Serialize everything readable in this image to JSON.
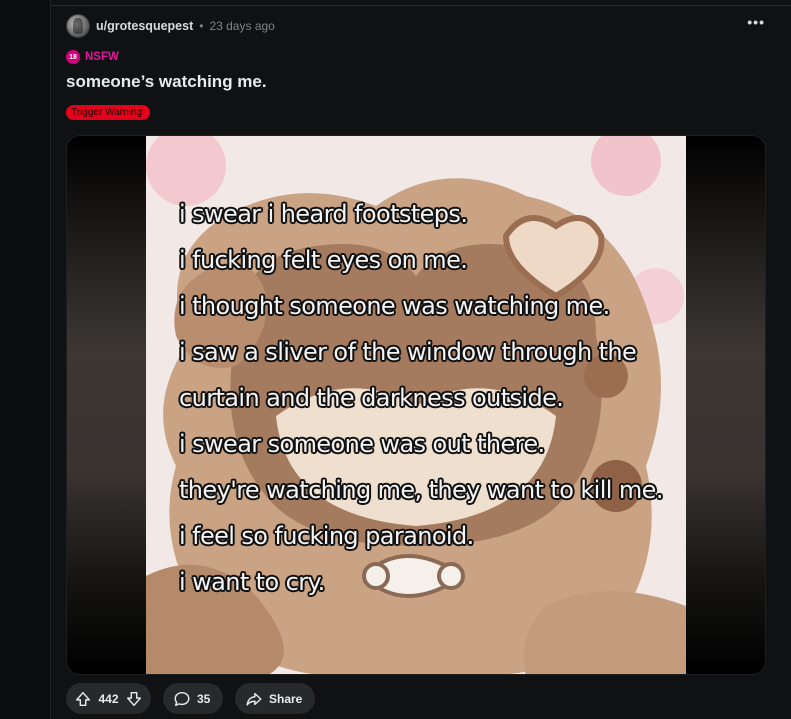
{
  "post": {
    "username": "u/grotesquepest",
    "separator": "•",
    "time": "23 days ago",
    "more_label": "•••",
    "nsfw_badge": "18",
    "nsfw_label": "NSFW",
    "title": "someone’s watching me.",
    "flair": "Trigger Warning:",
    "image_caption_lines": [
      "i swear i heard footsteps.",
      "i fucking felt eyes on me.",
      "i thought someone was watching me.",
      "i saw a sliver of the window through the",
      "curtain and the darkness outside.",
      "i swear someone was out there.",
      "they're watching me, they want to kill me.",
      "i feel so fucking paranoid.",
      "i want to cry."
    ]
  },
  "actions": {
    "upvote_count": "442",
    "comments_count": "35",
    "share_label": "Share"
  },
  "colors": {
    "nsfw": "#e4149c",
    "flair_bg": "#e5001c",
    "background": "#0b0c0d",
    "pill_bg": "#272a2d"
  },
  "icons": {
    "upvote": "arrow-up-icon",
    "downvote": "arrow-down-icon",
    "comments": "speech-bubble-icon",
    "share": "share-arrow-icon",
    "more": "ellipsis-icon"
  }
}
